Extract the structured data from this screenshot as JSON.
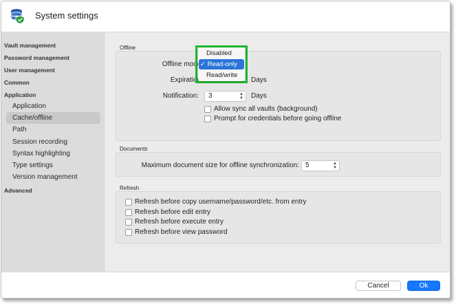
{
  "window": {
    "title": "System settings",
    "app_icon": "database-shield-icon"
  },
  "sidebar": {
    "items": [
      {
        "label": "Vault management",
        "type": "group"
      },
      {
        "label": "Password management",
        "type": "group"
      },
      {
        "label": "User management",
        "type": "group"
      },
      {
        "label": "Common",
        "type": "group"
      },
      {
        "label": "Application",
        "type": "group"
      },
      {
        "label": "Application",
        "type": "sub"
      },
      {
        "label": "Cache/offline",
        "type": "sub",
        "selected": true
      },
      {
        "label": "Path",
        "type": "sub"
      },
      {
        "label": "Session recording",
        "type": "sub"
      },
      {
        "label": "Syntax highlighting",
        "type": "sub"
      },
      {
        "label": "Type settings",
        "type": "sub"
      },
      {
        "label": "Version management",
        "type": "sub"
      },
      {
        "label": "Advanced",
        "type": "group"
      }
    ]
  },
  "offline": {
    "section_title": "Offline",
    "mode_label": "Offline mode:",
    "expiration_label": "Expiration:",
    "expiration_unit": "Days",
    "notification_label": "Notification:",
    "notification_value": "3",
    "notification_unit": "Days",
    "allow_sync_label": "Allow sync all vaults (background)",
    "allow_sync_checked": false,
    "prompt_credentials_label": "Prompt for credentials before going offline",
    "prompt_credentials_checked": false
  },
  "mode_dropdown": {
    "options": [
      "Disabled",
      "Read-only",
      "Read/write"
    ],
    "selected": "Read-only",
    "check_glyph": "✓",
    "highlight_color": "#1fb92e"
  },
  "documents": {
    "section_title": "Documents",
    "max_size_label": "Maximum document size for offline synchronization:",
    "max_size_value": "5"
  },
  "refresh": {
    "section_title": "Refresh",
    "options": [
      {
        "label": "Refresh before copy username/password/etc. from entry",
        "checked": false
      },
      {
        "label": "Refresh before edit entry",
        "checked": false
      },
      {
        "label": "Refresh before execute entry",
        "checked": false
      },
      {
        "label": "Refresh before view password",
        "checked": false
      }
    ]
  },
  "footer": {
    "cancel_label": "Cancel",
    "ok_label": "Ok",
    "ok_color": "#1677ff"
  }
}
